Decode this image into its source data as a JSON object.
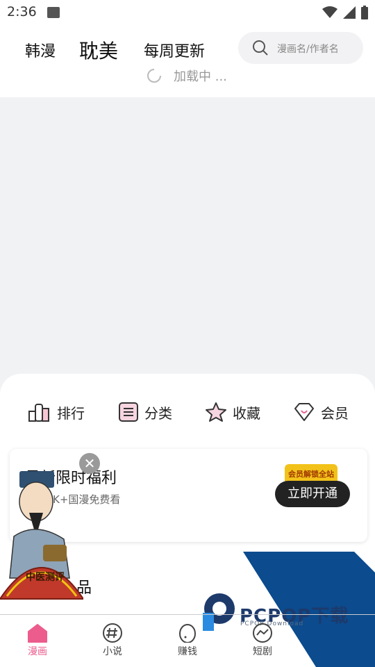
{
  "status_bar": {
    "time": "2:36"
  },
  "header": {
    "tabs": [
      {
        "label": "韩漫"
      },
      {
        "label": "耽美"
      },
      {
        "label": "每周更新"
      }
    ],
    "search_placeholder": "漫画名/作者名",
    "loading_text": "加载中 ..."
  },
  "quick_actions": [
    {
      "label": "排行",
      "icon": "bar-chart-icon"
    },
    {
      "label": "分类",
      "icon": "list-icon"
    },
    {
      "label": "收藏",
      "icon": "star-icon"
    },
    {
      "label": "会员",
      "icon": "diamond-icon"
    }
  ],
  "promo": {
    "title": "最新限时福利",
    "subtitle": "K+国漫免费看",
    "badge": "会员解锁全站",
    "button": "立即开通"
  },
  "section_partial_title": "品",
  "overlay_ad": {
    "label": "中医测评"
  },
  "watermark": {
    "text": "PCPOP下载",
    "sub": "PCPOP Download"
  },
  "bottom_nav": [
    {
      "label": "漫画",
      "icon": "home-icon"
    },
    {
      "label": "小说",
      "icon": "hashtag-icon"
    },
    {
      "label": "赚钱",
      "icon": "egg-icon"
    },
    {
      "label": "短剧",
      "icon": "trend-icon"
    }
  ],
  "colors": {
    "accent": "#ec5d8d",
    "promo_button": "#222222",
    "badge": "#f2c21a"
  }
}
